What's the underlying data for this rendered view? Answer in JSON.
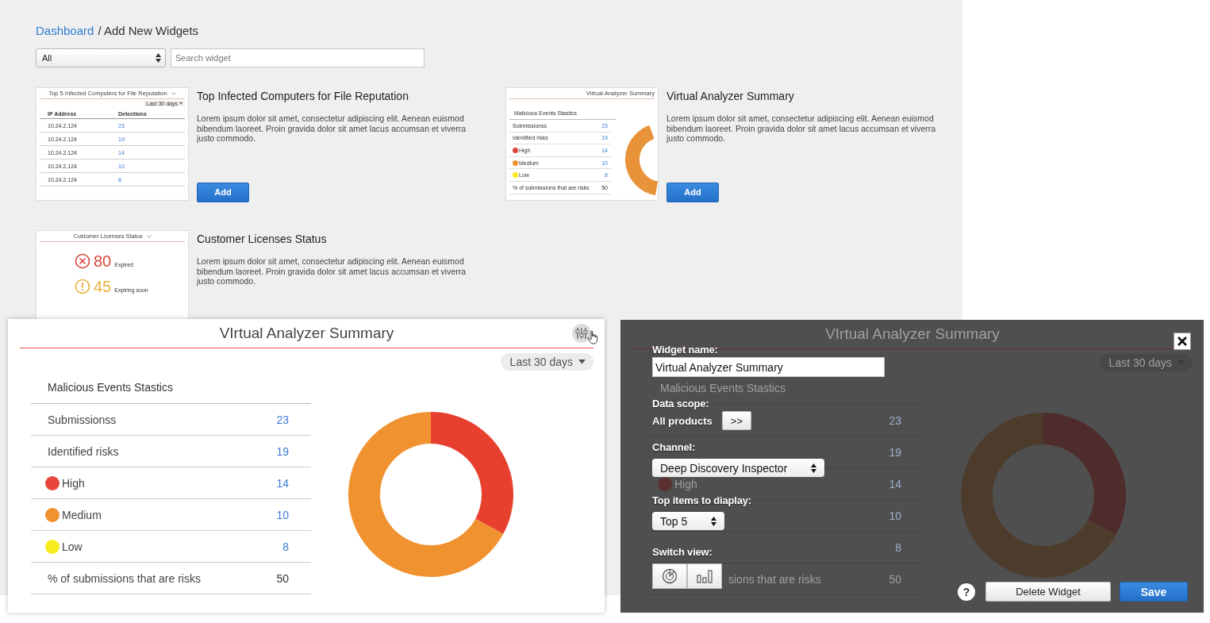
{
  "breadcrumb": {
    "link": "Dashboard",
    "current": "/ Add New Widgets"
  },
  "category_filter": {
    "value": "All"
  },
  "search": {
    "placeholder": "Search widget"
  },
  "widgets": [
    {
      "kind": "table",
      "title": "Top Infected Computers for File Reputation",
      "description": "Lorem ipsum dolor sit amet, consectetur adipiscing elit. Aenean euismod bibendum laoreet. Proin gravida dolor sit amet lacus accumsan et viverra justo commodo.",
      "button": "Add",
      "preview": {
        "title": "Top 5 Infected Computers for File Reputation",
        "range": "Last 30 days",
        "columns": [
          "IP Address",
          "Detections"
        ],
        "rows": [
          [
            "10.24.2.124",
            "23"
          ],
          [
            "10.24.2.124",
            "19"
          ],
          [
            "10.24.2.124",
            "14"
          ],
          [
            "10.24.2.124",
            "10"
          ],
          [
            "10.24.2.124",
            "8"
          ]
        ]
      }
    },
    {
      "kind": "summary",
      "title": "Virtual Analyzer Summary",
      "description": "Lorem ipsum dolor sit amet, consectetur adipiscing elit. Aenean euismod bibendum laoreet. Proin gravida dolor sit amet lacus accumsan et viverra justo commodo.",
      "button": "Add",
      "preview": {
        "title": "Virtual Analyzer Summary",
        "heading": "Malicious Events Stastics",
        "rows": [
          {
            "label": "Submissionss",
            "value": "23"
          },
          {
            "label": "Identified risks",
            "value": "19"
          },
          {
            "label": "High",
            "value": "14",
            "color": "#d9453a"
          },
          {
            "label": "Medium",
            "value": "10",
            "color": "#f0922f"
          },
          {
            "label": "Low",
            "value": "8",
            "color": "#f7e91e"
          },
          {
            "label": "% of submissions that are risks",
            "value": "50"
          }
        ]
      }
    },
    {
      "kind": "licenses",
      "title": "Customer Licenses Status",
      "description": "Lorem ipsum dolor sit amet, consectetur adipiscing elit. Aenean euismod bibendum laoreet. Proin gravida dolor sit amet lacus accumsan et viverra justo commodo.",
      "preview": {
        "title": "Customer Licenses Status",
        "items": [
          {
            "kind": "expired",
            "value": "80",
            "label": "Expired"
          },
          {
            "kind": "expiring",
            "value": "45",
            "label": "Expiring soon"
          }
        ]
      }
    }
  ],
  "summary_widget": {
    "title": "VIrtual Analyzer Summary",
    "range": "Last 30 days",
    "heading": "Malicious Events Stastics",
    "rows": [
      {
        "label": "Submissionss",
        "value": "23"
      },
      {
        "label": "Identified risks",
        "value": "19"
      },
      {
        "label": "High",
        "value": "14",
        "color": "#e8463a"
      },
      {
        "label": "Medium",
        "value": "10",
        "color": "#f0922f"
      },
      {
        "label": "Low",
        "value": "8",
        "color": "#f9ec1c"
      },
      {
        "label": "% of submissions that are risks",
        "value": "50"
      }
    ]
  },
  "settings_dialog": {
    "underlay": {
      "title": "VIrtual Analyzer Summary",
      "range": "Last 30 days",
      "heading": "Malicious Events Stastics",
      "rows": [
        {
          "value": "23"
        },
        {
          "value": "19"
        },
        {
          "label": "High",
          "value": "14",
          "color": "#5c3030"
        },
        {
          "value": "10"
        },
        {
          "value": "8"
        },
        {
          "kind": "partial",
          "label": "sions that are risks",
          "value": "50"
        }
      ]
    },
    "fields": [
      {
        "kind": "text",
        "label": "Widget name:",
        "value": "Virtual Analyzer Summary"
      },
      {
        "kind": "scope",
        "label": "Data scope:",
        "value": "All products",
        "button": ">>"
      },
      {
        "kind": "select",
        "label": "Channel:",
        "value": "Deep Discovery Inspector"
      },
      {
        "kind": "select",
        "label": "Top items to diaplay:",
        "value": "Top 5"
      },
      {
        "kind": "views",
        "label": "Switch view:"
      }
    ],
    "help": "?",
    "delete_button": "Delete Widget",
    "save_button": "Save"
  }
}
